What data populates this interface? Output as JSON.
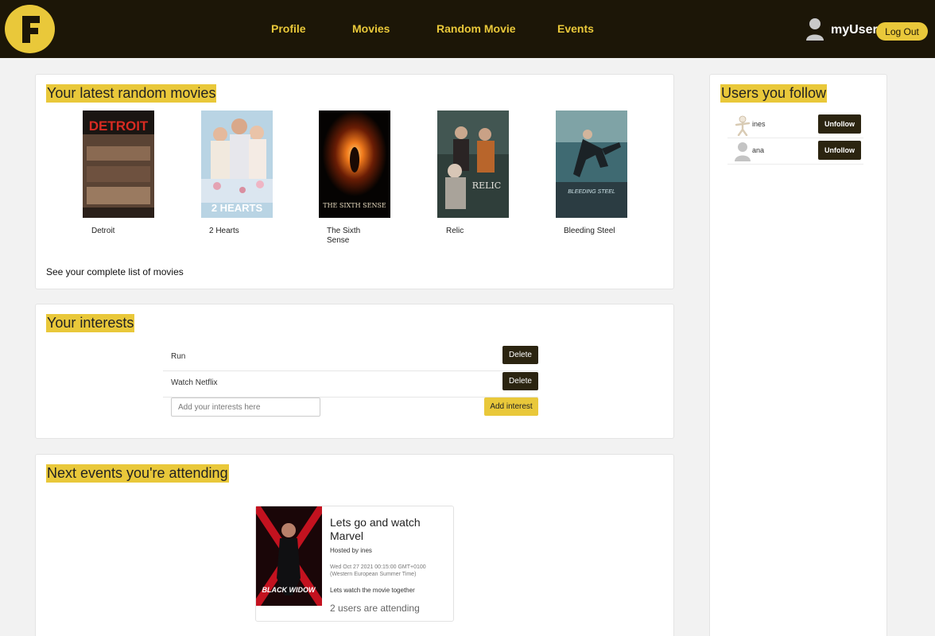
{
  "nav": {
    "logo_letter": "F",
    "links": [
      "Profile",
      "Movies",
      "Random Movie",
      "Events"
    ],
    "username": "myUser",
    "logout_label": "Log Out",
    "accent_color": "#e9c83a",
    "bar_color": "#1c1607"
  },
  "random_movies": {
    "title": "Your latest random movies",
    "movies": [
      {
        "title": "Detroit",
        "poster_text": "DETROIT"
      },
      {
        "title": "2 Hearts",
        "poster_text": "2 HEARTS"
      },
      {
        "title": "The Sixth Sense",
        "poster_text": "THE SIXTH SENSE"
      },
      {
        "title": "Relic",
        "poster_text": "RELIC"
      },
      {
        "title": "Bleeding Steel",
        "poster_text": "BLEEDING STEEL"
      }
    ],
    "see_list_label": "See your complete list of movies"
  },
  "interests": {
    "title": "Your interests",
    "items": [
      {
        "label": "Run",
        "delete_label": "Delete"
      },
      {
        "label": "Watch Netflix",
        "delete_label": "Delete"
      }
    ],
    "input_placeholder": "Add your interests here",
    "add_label": "Add interest"
  },
  "events": {
    "title": "Next events you're attending",
    "items": [
      {
        "poster_text": "BLACK WIDOW",
        "title": "Lets go and watch Marvel",
        "host": "Hosted by ines",
        "date": "Wed Oct 27 2021 00:15:00 GMT+0100 (Western European Summer Time)",
        "description": "Lets watch the movie together",
        "attending": "2 users are attending"
      }
    ]
  },
  "following": {
    "title": "Users you follow",
    "users": [
      {
        "name": "ines",
        "unfollow_label": "Unfollow",
        "avatar": "figure-icon"
      },
      {
        "name": "ana",
        "unfollow_label": "Unfollow",
        "avatar": "user-silhouette-icon"
      }
    ]
  }
}
